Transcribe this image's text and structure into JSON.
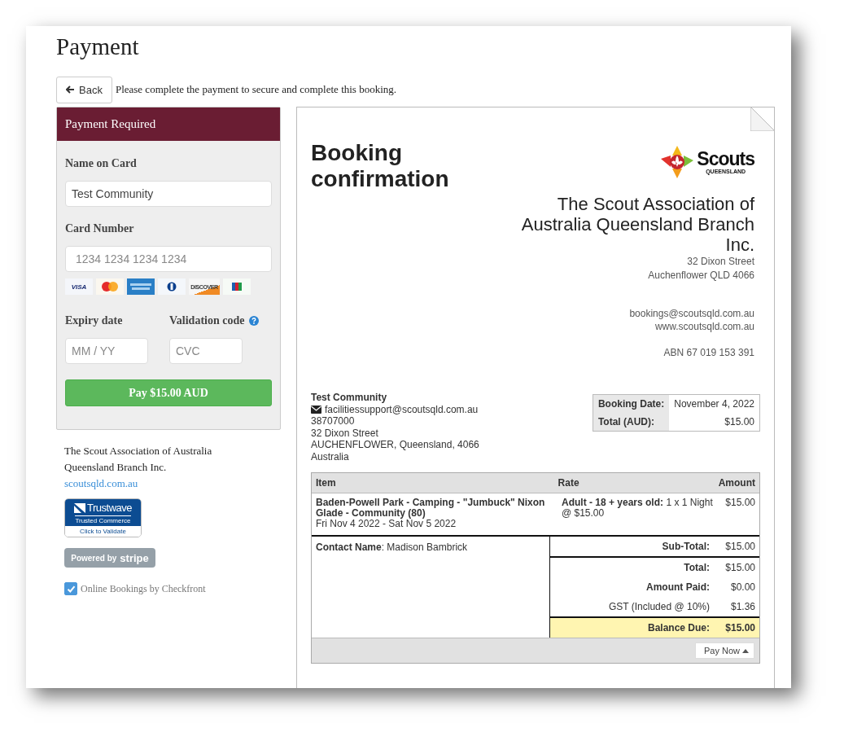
{
  "page": {
    "title": "Payment",
    "back_button": "Back",
    "intro": "Please complete the payment to secure and complete this booking."
  },
  "payment_panel": {
    "header": "Payment Required",
    "name_on_card": {
      "label": "Name on Card",
      "value": "Test Community"
    },
    "card_number": {
      "label": "Card Number",
      "placeholder": "1234 1234 1234 1234"
    },
    "card_logos": [
      {
        "kind": "visa",
        "text": "VISA"
      },
      {
        "kind": "mastercard"
      },
      {
        "kind": "amex"
      },
      {
        "kind": "diners"
      },
      {
        "kind": "discover",
        "text": "DISCOVER"
      },
      {
        "kind": "jcb"
      }
    ],
    "expiry": {
      "label": "Expiry date",
      "placeholder": "MM / YY"
    },
    "cvc": {
      "label": "Validation code",
      "placeholder": "CVC"
    },
    "pay_button": "Pay $15.00 AUD"
  },
  "merchant": {
    "name": "The Scout Association of Australia Queensland Branch Inc.",
    "link": "scoutsqld.com.au"
  },
  "trustwave_badge": {
    "brand": "Trustwave",
    "tagline": "Trusted Commerce",
    "action": "Click to Validate"
  },
  "stripe_badge": {
    "prefix": "Powered by",
    "brand": "stripe"
  },
  "checkfront": {
    "checked": true,
    "label": "Online Bookings by Checkfront"
  },
  "document": {
    "title": "Booking confirmation",
    "logo": {
      "name": "Scouts",
      "region": "QUEENSLAND"
    },
    "org": {
      "name": "The Scout Association of Australia Queensland Branch Inc.",
      "address": [
        "32 Dixon Street",
        "Auchenflower QLD 4066"
      ],
      "contact": [
        "bookings@scoutsqld.com.au",
        "www.scoutsqld.com.au"
      ],
      "abn": "ABN 67 019 153 391"
    },
    "customer": {
      "name": "Test Community",
      "email": "facilitiessupport@scoutsqld.com.au",
      "lines": [
        "38707000",
        "32 Dixon Street",
        "AUCHENFLOWER, Queensland, 4066",
        "Australia"
      ]
    },
    "summary": [
      {
        "label": "Booking Date:",
        "value": "November 4, 2022"
      },
      {
        "label": "Total (AUD):",
        "value": "$15.00"
      }
    ],
    "items_table": {
      "columns": [
        "Item",
        "Rate",
        "Amount"
      ],
      "rows": [
        {
          "item": "Baden-Powell Park - Camping - \"Jumbuck\" Nixon Glade - Community (80)",
          "dates": "Fri Nov 4 2022 - Sat Nov 5 2022",
          "rate": "**Adult - 18 + years old:** 1 x 1 Night @ $15.00",
          "amount": "$15.00"
        }
      ]
    },
    "contact": "**Contact Name**: Madison Bambrick",
    "totals": [
      {
        "kind": "subtotal",
        "label": "Sub-Total:",
        "value": "$15.00"
      },
      {
        "kind": "total",
        "label": "Total:",
        "value": "$15.00"
      },
      {
        "kind": "total",
        "label": "Amount Paid:",
        "value": "$0.00"
      },
      {
        "kind": "tax",
        "label": "GST (Included @ 10%)",
        "value": "$1.36"
      },
      {
        "kind": "balance",
        "label": "Balance Due:",
        "value": "$15.00"
      }
    ],
    "pay_now": "Pay Now"
  }
}
